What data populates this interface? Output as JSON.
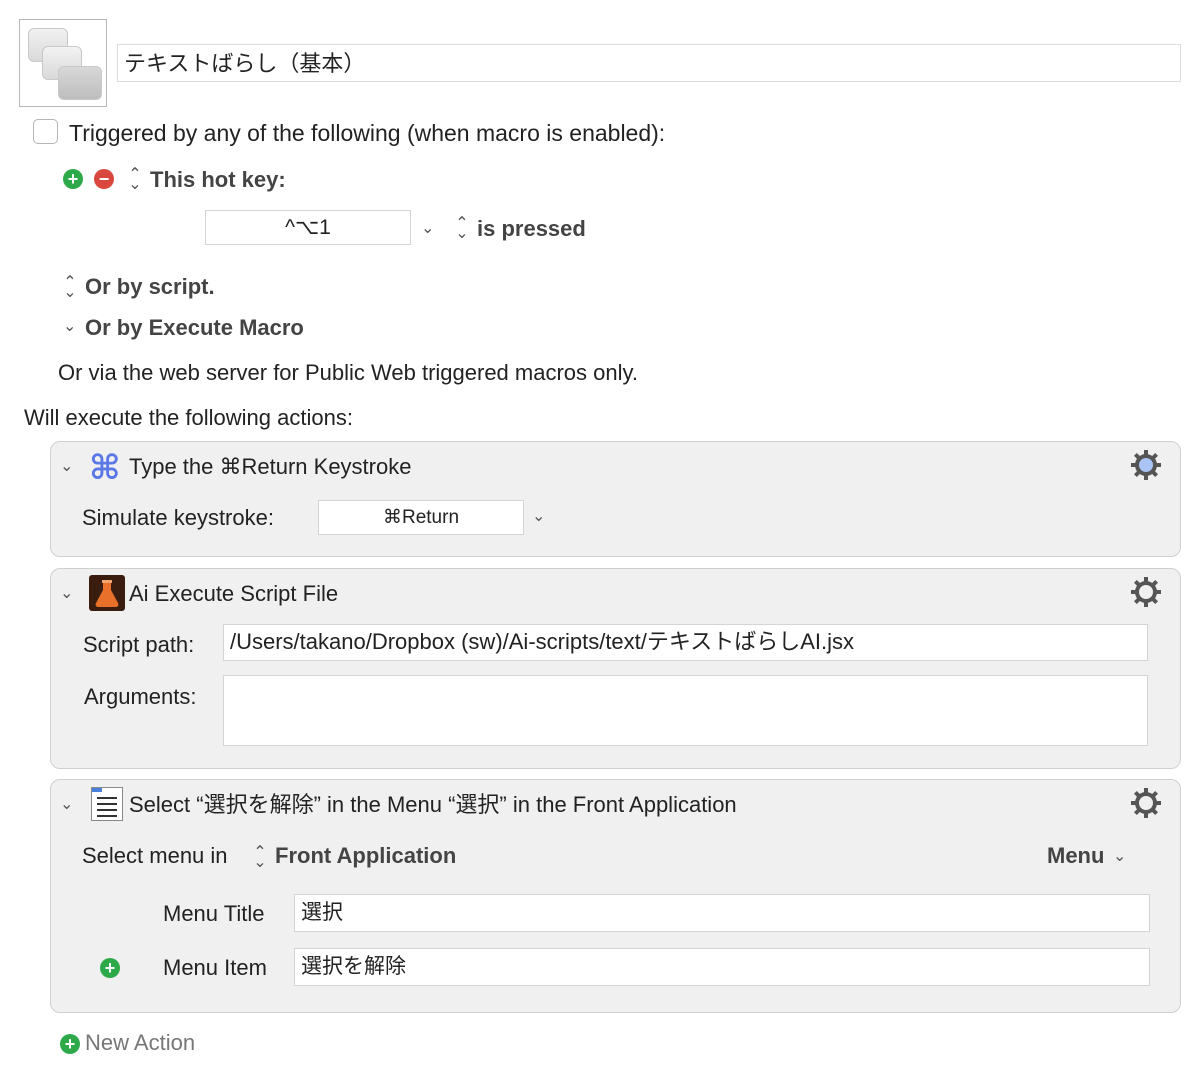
{
  "macro": {
    "name": "テキストばらし（基本）",
    "trigger_header": "Triggered by any of the following (when macro is enabled):",
    "hotkey_label": "This hot key:",
    "hotkey_value": "^⌥1",
    "hotkey_condition": "is pressed",
    "or_by_script": "Or by script.",
    "or_by_execute_macro": "Or by Execute Macro",
    "or_via_web": "Or via the web server for Public Web triggered macros only.",
    "will_execute": "Will execute the following actions:"
  },
  "actions": [
    {
      "title": "Type the ⌘Return Keystroke",
      "simulate_label": "Simulate keystroke:",
      "keystroke": "⌘Return",
      "icon": "command-icon"
    },
    {
      "title": "Ai Execute Script File",
      "script_path_label": "Script path:",
      "script_path": "/Users/takano/Dropbox (sw)/Ai-scripts/text/テキストばらしAI.jsx",
      "arguments_label": "Arguments:",
      "arguments": "",
      "icon": "flask-icon"
    },
    {
      "title": "Select “選択を解除” in the Menu “選択” in the Front Application",
      "select_menu_label": "Select menu in",
      "target_app": "Front Application",
      "menu_dropdown": "Menu",
      "menu_title_label": "Menu Title",
      "menu_title": "選択",
      "menu_item_label": "Menu Item",
      "menu_item": "選択を解除",
      "icon": "menu-list-icon"
    }
  ],
  "new_action": "New Action",
  "colors": {
    "add_green": "#2ea94a",
    "remove_red": "#d9473f",
    "ai_orange": "#e8702a",
    "ai_dark": "#3a1d0e"
  }
}
